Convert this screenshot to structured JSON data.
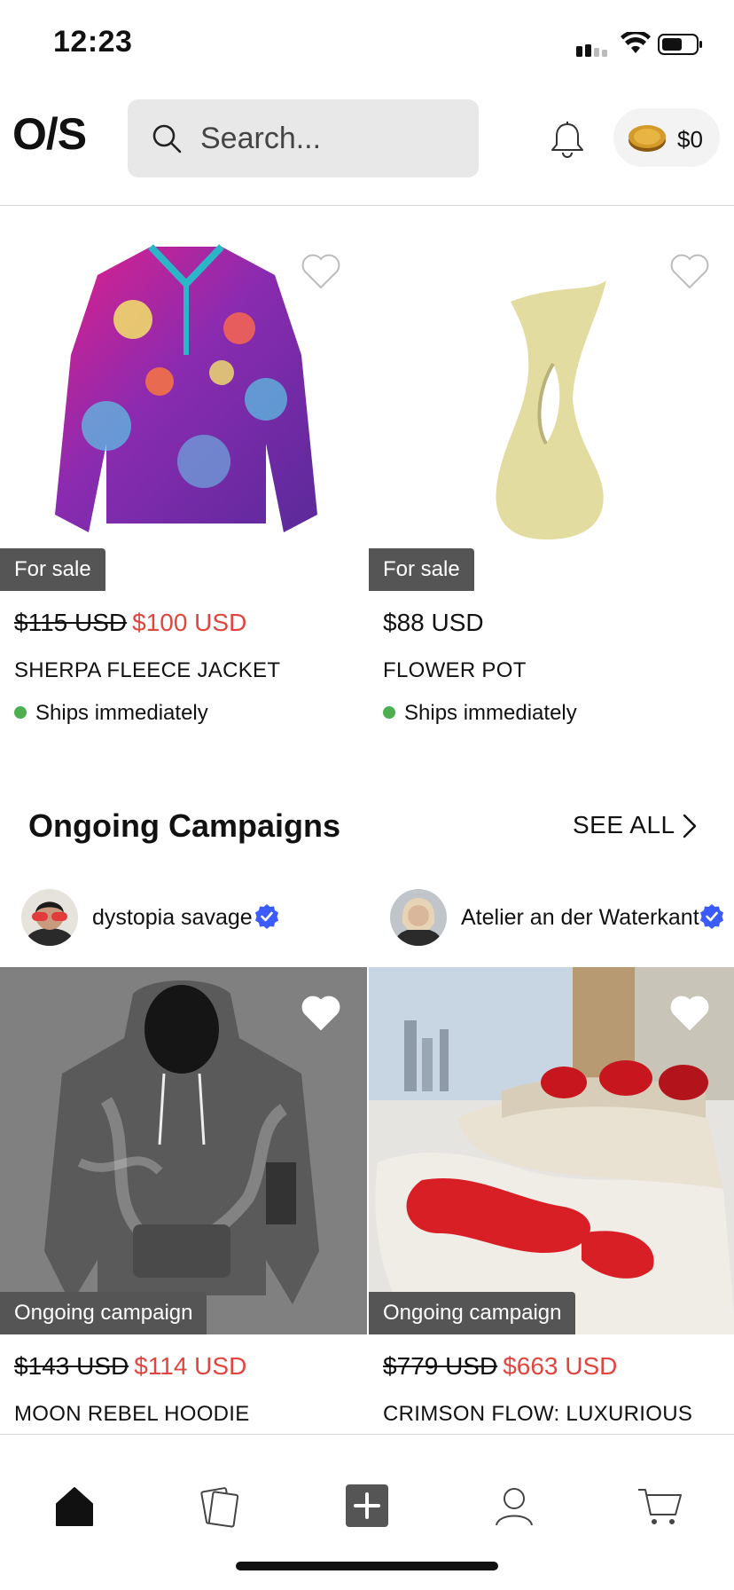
{
  "status_bar": {
    "time": "12:23"
  },
  "header": {
    "logo": "O/S",
    "search_placeholder": "Search...",
    "wallet_amount": "$0"
  },
  "products_for_sale": [
    {
      "badge": "For sale",
      "old_price": "$115 USD",
      "price": "$100 USD",
      "title": "SHERPA FLEECE JACKET",
      "shipping": "Ships immediately"
    },
    {
      "badge": "For sale",
      "old_price": "",
      "price": "$88 USD",
      "title": "FLOWER POT",
      "shipping": "Ships immediately"
    }
  ],
  "campaigns_section": {
    "title": "Ongoing Campaigns",
    "see_all": "SEE ALL"
  },
  "sellers": [
    {
      "name": "dystopia savage"
    },
    {
      "name": "Atelier an der Waterkant"
    }
  ],
  "campaign_products": [
    {
      "badge": "Ongoing campaign",
      "old_price": "$143 USD",
      "price": "$114 USD",
      "title": "MOON REBEL HOODIE"
    },
    {
      "badge": "Ongoing campaign",
      "old_price": "$779 USD",
      "price": "$663 USD",
      "title": "CRIMSON FLOW: LUXURIOUS"
    }
  ],
  "colors": {
    "sale_price": "#e0453e",
    "badge_bg": "#555555",
    "in_stock_dot": "#4caf50",
    "verified": "#3b5bfd"
  },
  "icons": {
    "nav": [
      "home-icon",
      "cards-icon",
      "add-icon",
      "profile-icon",
      "cart-icon"
    ]
  }
}
